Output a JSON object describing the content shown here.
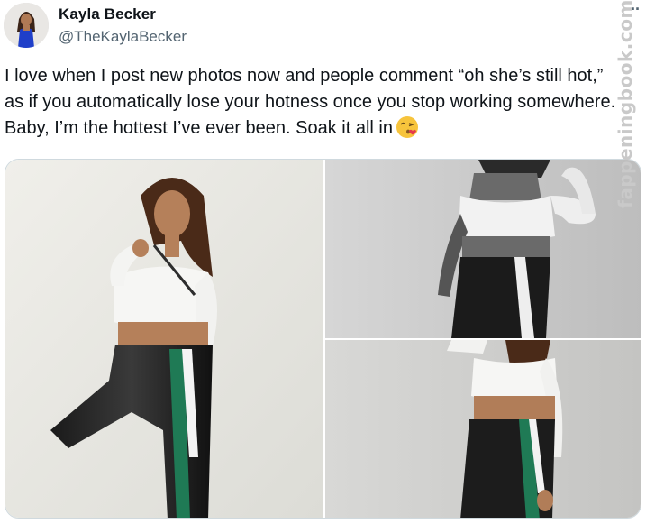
{
  "tweet": {
    "author_name": "Kayla Becker",
    "author_handle": "@TheKaylaBecker",
    "more_label": "··",
    "text": "I love when I post new photos now and people comment “oh she’s still hot,” as if you automatically lose your hotness once you stop working somewhere. Baby, I’m the hottest I’ve ever been. Soak it all in",
    "emoji": "face-blowing-kiss-icon"
  },
  "media": {
    "count": 3,
    "photos": [
      "photo-1",
      "photo-2",
      "photo-3"
    ]
  },
  "watermark": {
    "text": "fappeningbook.com"
  },
  "colors": {
    "text": "#0f1419",
    "secondary": "#536471",
    "border": "#cfd9de",
    "watermark": "#c9c9c9"
  }
}
